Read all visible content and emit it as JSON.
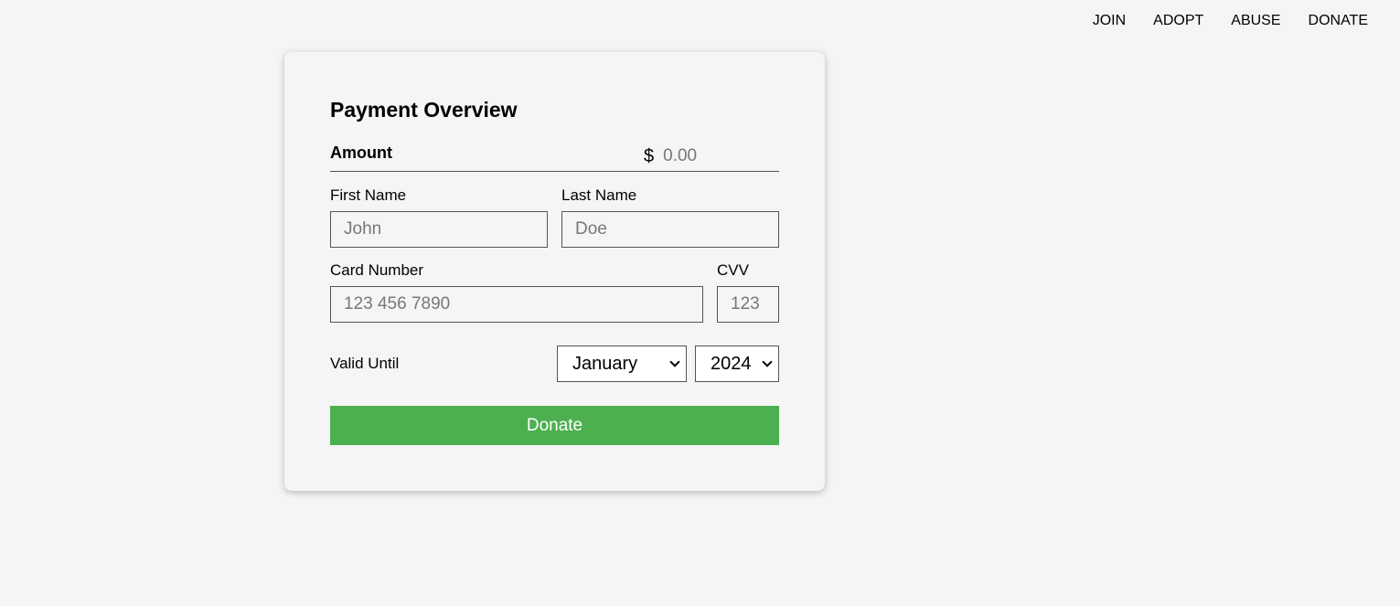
{
  "nav": {
    "items": [
      {
        "label": "JOIN"
      },
      {
        "label": "ADOPT"
      },
      {
        "label": "ABUSE"
      },
      {
        "label": "DONATE"
      }
    ]
  },
  "form": {
    "title": "Payment Overview",
    "amount": {
      "label": "Amount",
      "currency_symbol": "$",
      "placeholder": "0.00",
      "value": ""
    },
    "first_name": {
      "label": "First Name",
      "placeholder": "John",
      "value": ""
    },
    "last_name": {
      "label": "Last Name",
      "placeholder": "Doe",
      "value": ""
    },
    "card_number": {
      "label": "Card Number",
      "placeholder": "123 456 7890",
      "value": ""
    },
    "cvv": {
      "label": "CVV",
      "placeholder": "123",
      "value": ""
    },
    "valid_until": {
      "label": "Valid Until",
      "month": "January",
      "year": "2024"
    },
    "submit_label": "Donate"
  },
  "colors": {
    "background": "#f5f5f5",
    "button": "#4caf50",
    "button_text": "#ffffff"
  }
}
